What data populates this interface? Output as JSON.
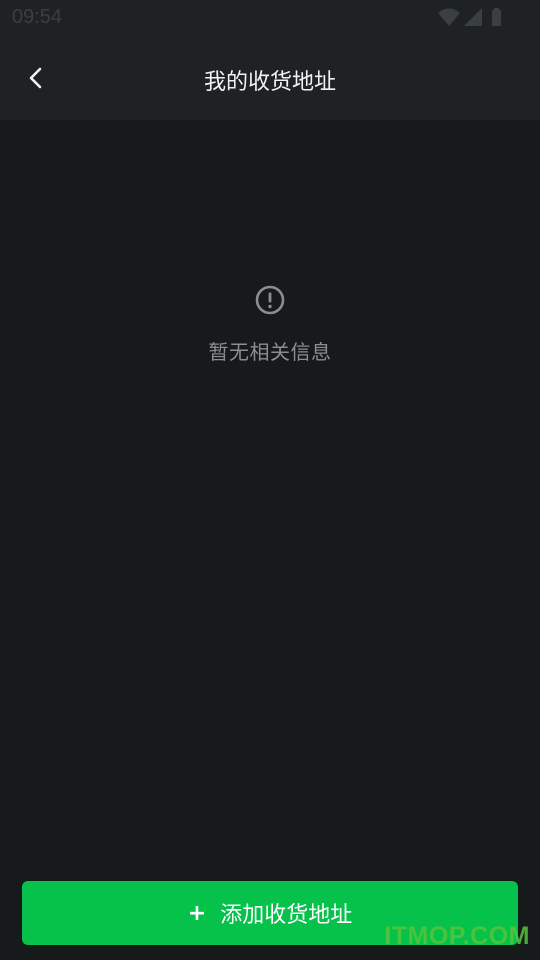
{
  "status_bar": {
    "time": "09:54",
    "icons": [
      "wifi-icon",
      "cell-signal-icon",
      "battery-icon"
    ]
  },
  "header": {
    "back_icon": "chevron-left-icon",
    "title": "我的收货地址"
  },
  "empty_state": {
    "icon": "exclamation-circle-icon",
    "message": "暂无相关信息"
  },
  "add_button": {
    "plus": "+",
    "label": "添加收货地址",
    "color": "#06c14a"
  },
  "watermark": {
    "text": "ITMOP.COM"
  },
  "colors": {
    "background": "#161a1b",
    "header_background": "#1e2224",
    "accent": "#06c14a"
  }
}
